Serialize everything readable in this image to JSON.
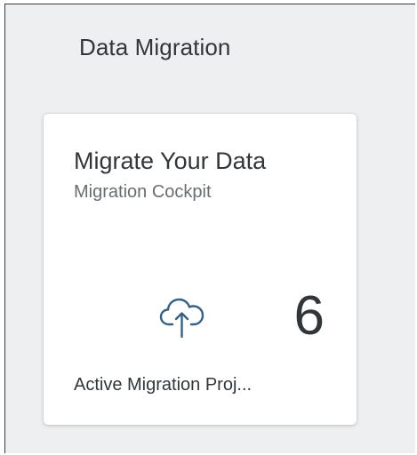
{
  "group": {
    "title": "Data Migration"
  },
  "tile": {
    "title": "Migrate Your Data",
    "subtitle": "Migration Cockpit",
    "icon": "cloud-upload-icon",
    "kpi_value": "6",
    "footer": "Active Migration Proj...",
    "icon_color": "#346187"
  }
}
